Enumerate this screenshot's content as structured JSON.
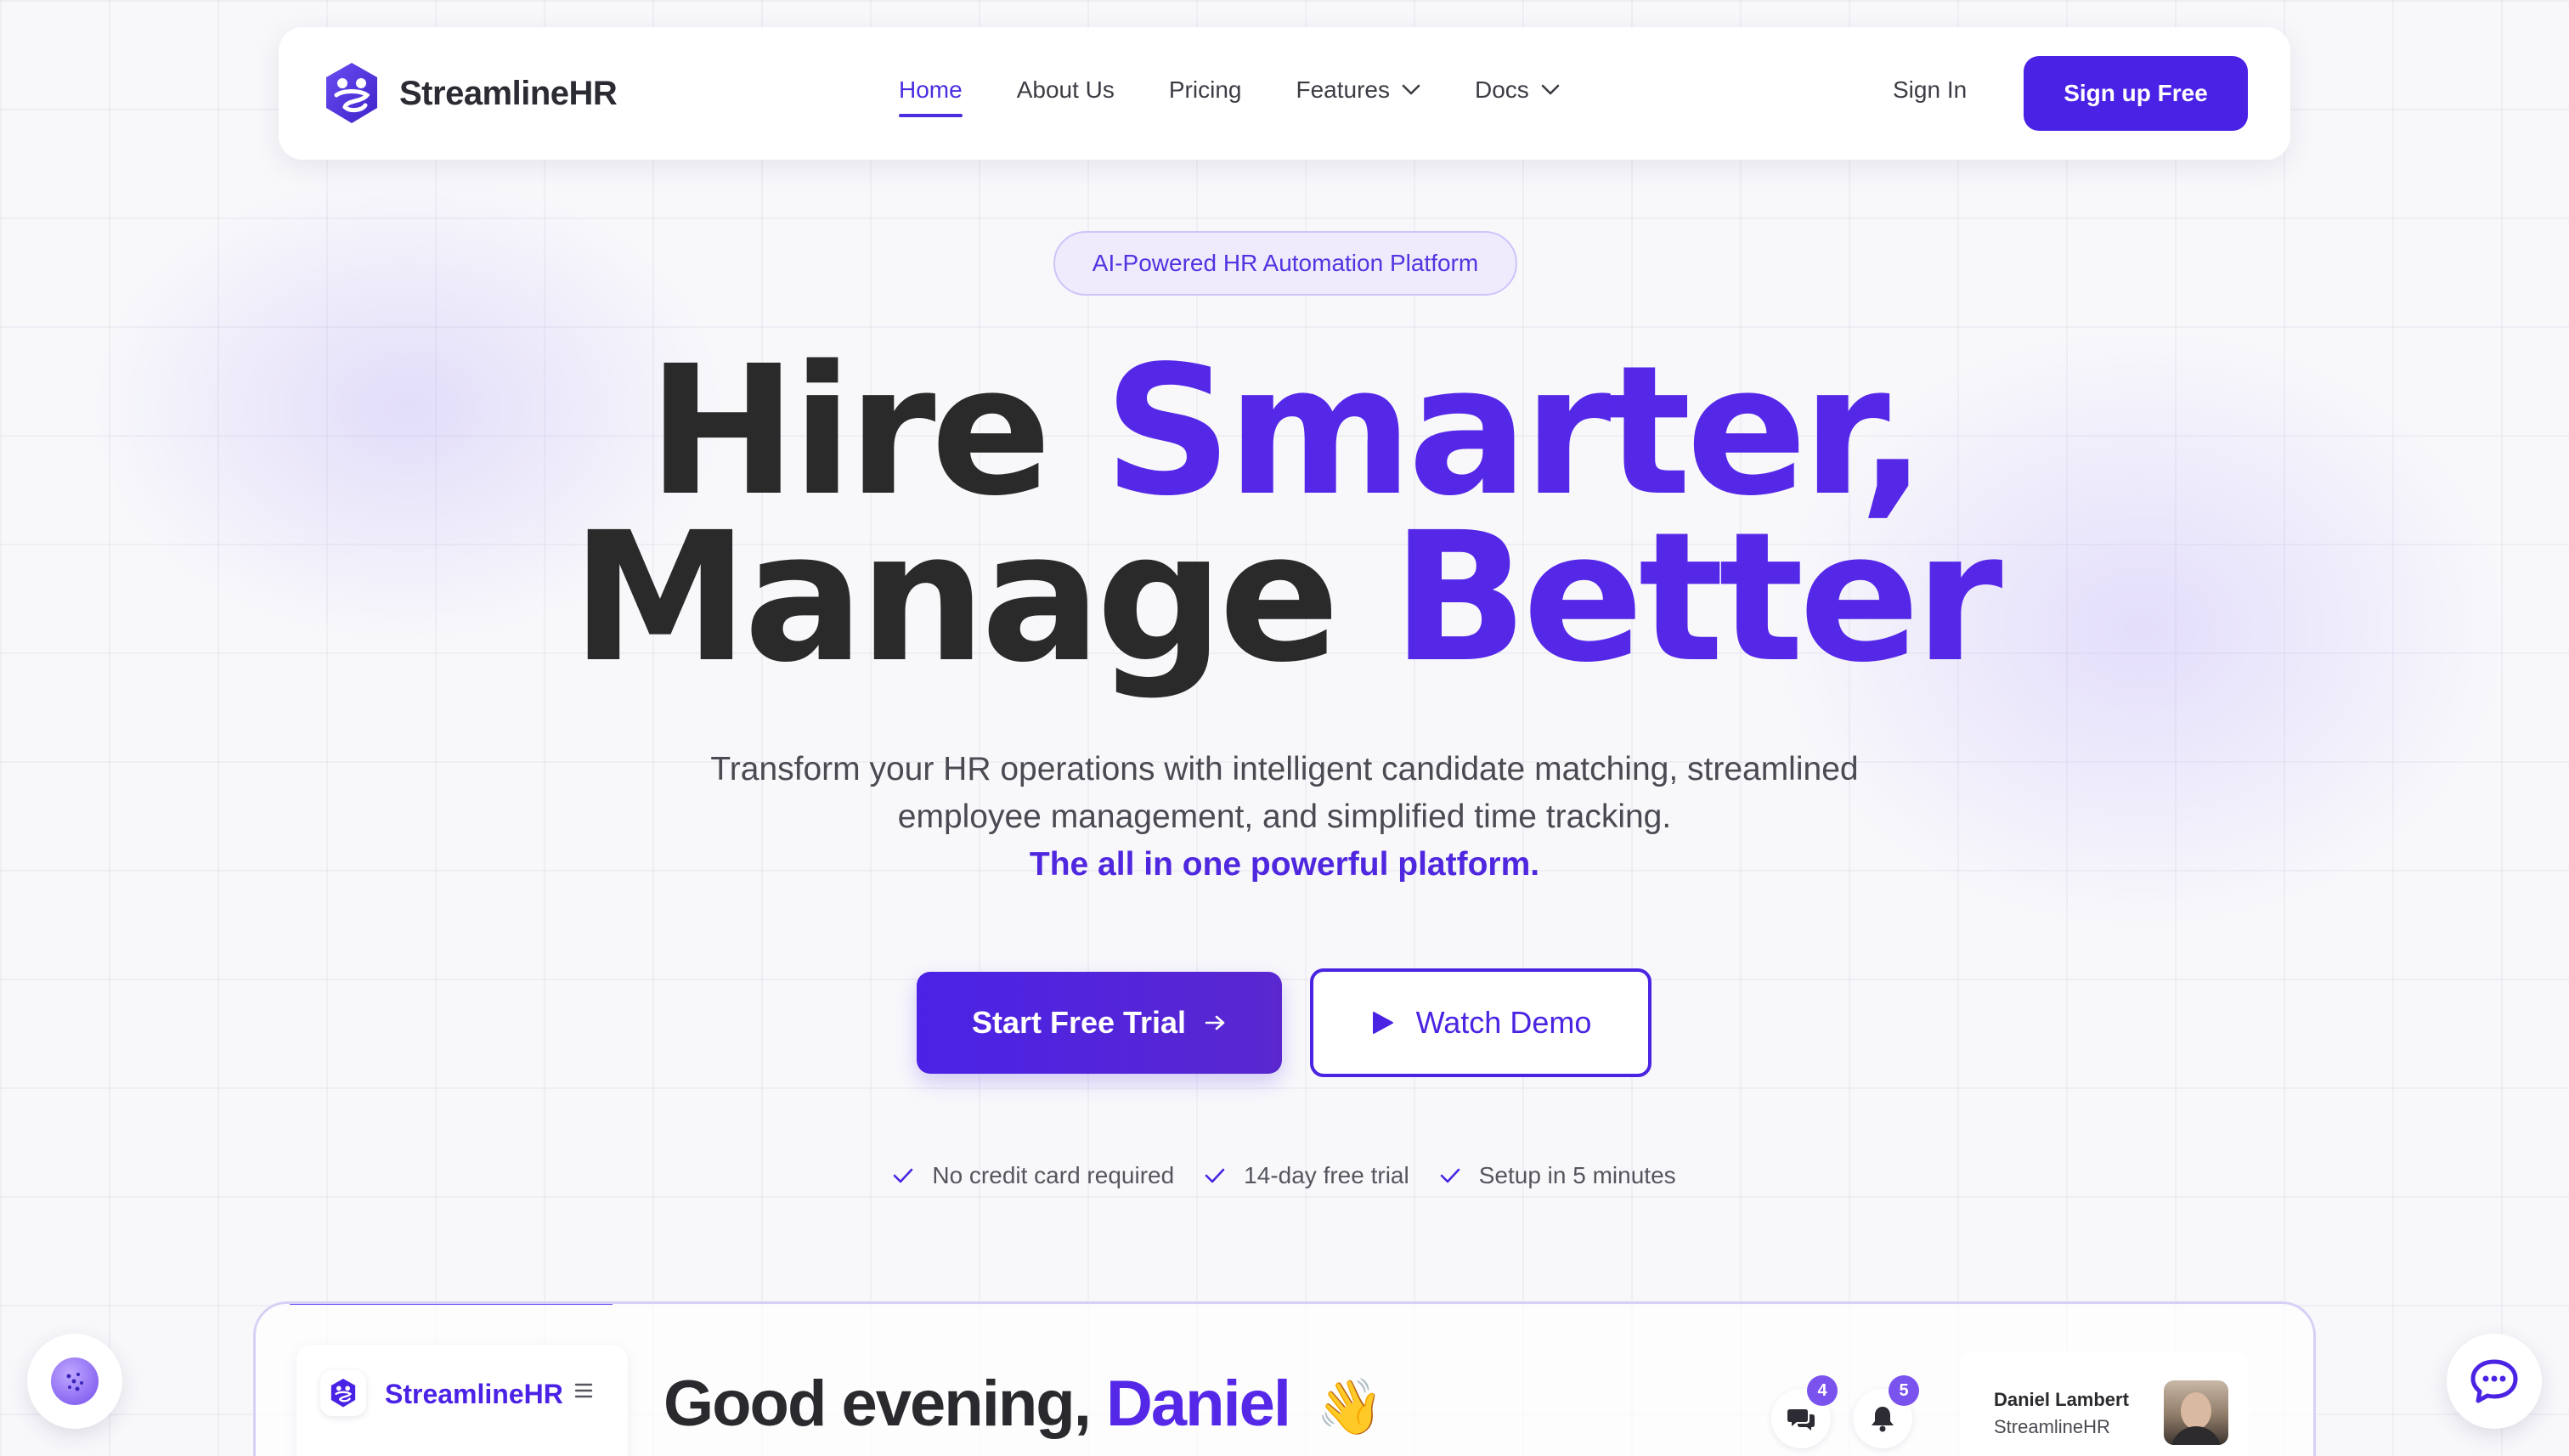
{
  "brand": {
    "name": "StreamlineHR"
  },
  "nav": {
    "items": [
      {
        "label": "Home",
        "active": true
      },
      {
        "label": "About Us",
        "active": false
      },
      {
        "label": "Pricing",
        "active": false
      },
      {
        "label": "Features",
        "active": false,
        "dropdown": true
      },
      {
        "label": "Docs",
        "active": false,
        "dropdown": true
      }
    ],
    "signin": "Sign In",
    "signup": "Sign up Free"
  },
  "hero": {
    "badge": "AI-Powered HR Automation Platform",
    "headline_line1_plain": "Hire",
    "headline_line1_accent": "Smarter,",
    "headline_line2_plain": "Manage",
    "headline_line2_accent": "Better",
    "sub_line1": "Transform your HR operations with intelligent candidate matching, streamlined",
    "sub_line2": "employee management, and simplified time tracking.",
    "sub_line3": "The all in one powerful platform.",
    "cta_primary": "Start Free Trial",
    "cta_secondary": "Watch Demo",
    "trust": [
      "No credit card required",
      "14-day free trial",
      "Setup in 5 minutes"
    ]
  },
  "dashboard": {
    "brand": "StreamlineHR",
    "greeting": "Good evening,",
    "greeting_name": "Daniel",
    "wave": "👋",
    "messages_count": "4",
    "notifications_count": "5",
    "user_name": "Daniel Lambert",
    "user_company": "StreamlineHR"
  },
  "colors": {
    "accent": "#5528e8",
    "primary_button": "#4a22e6",
    "text_dark": "#2a2a2a",
    "background": "#f8f8fb"
  },
  "icons": {
    "brand": "brand-logo-icon",
    "dropdown": "chevron-down-icon",
    "cta_arrow": "arrow-right-icon",
    "play": "play-icon",
    "check": "check-icon",
    "menu": "hamburger-menu-icon",
    "messages": "chat-bubbles-icon",
    "notifications": "bell-icon",
    "assistant": "sparkle-assistant-icon",
    "chat": "chat-support-icon"
  }
}
